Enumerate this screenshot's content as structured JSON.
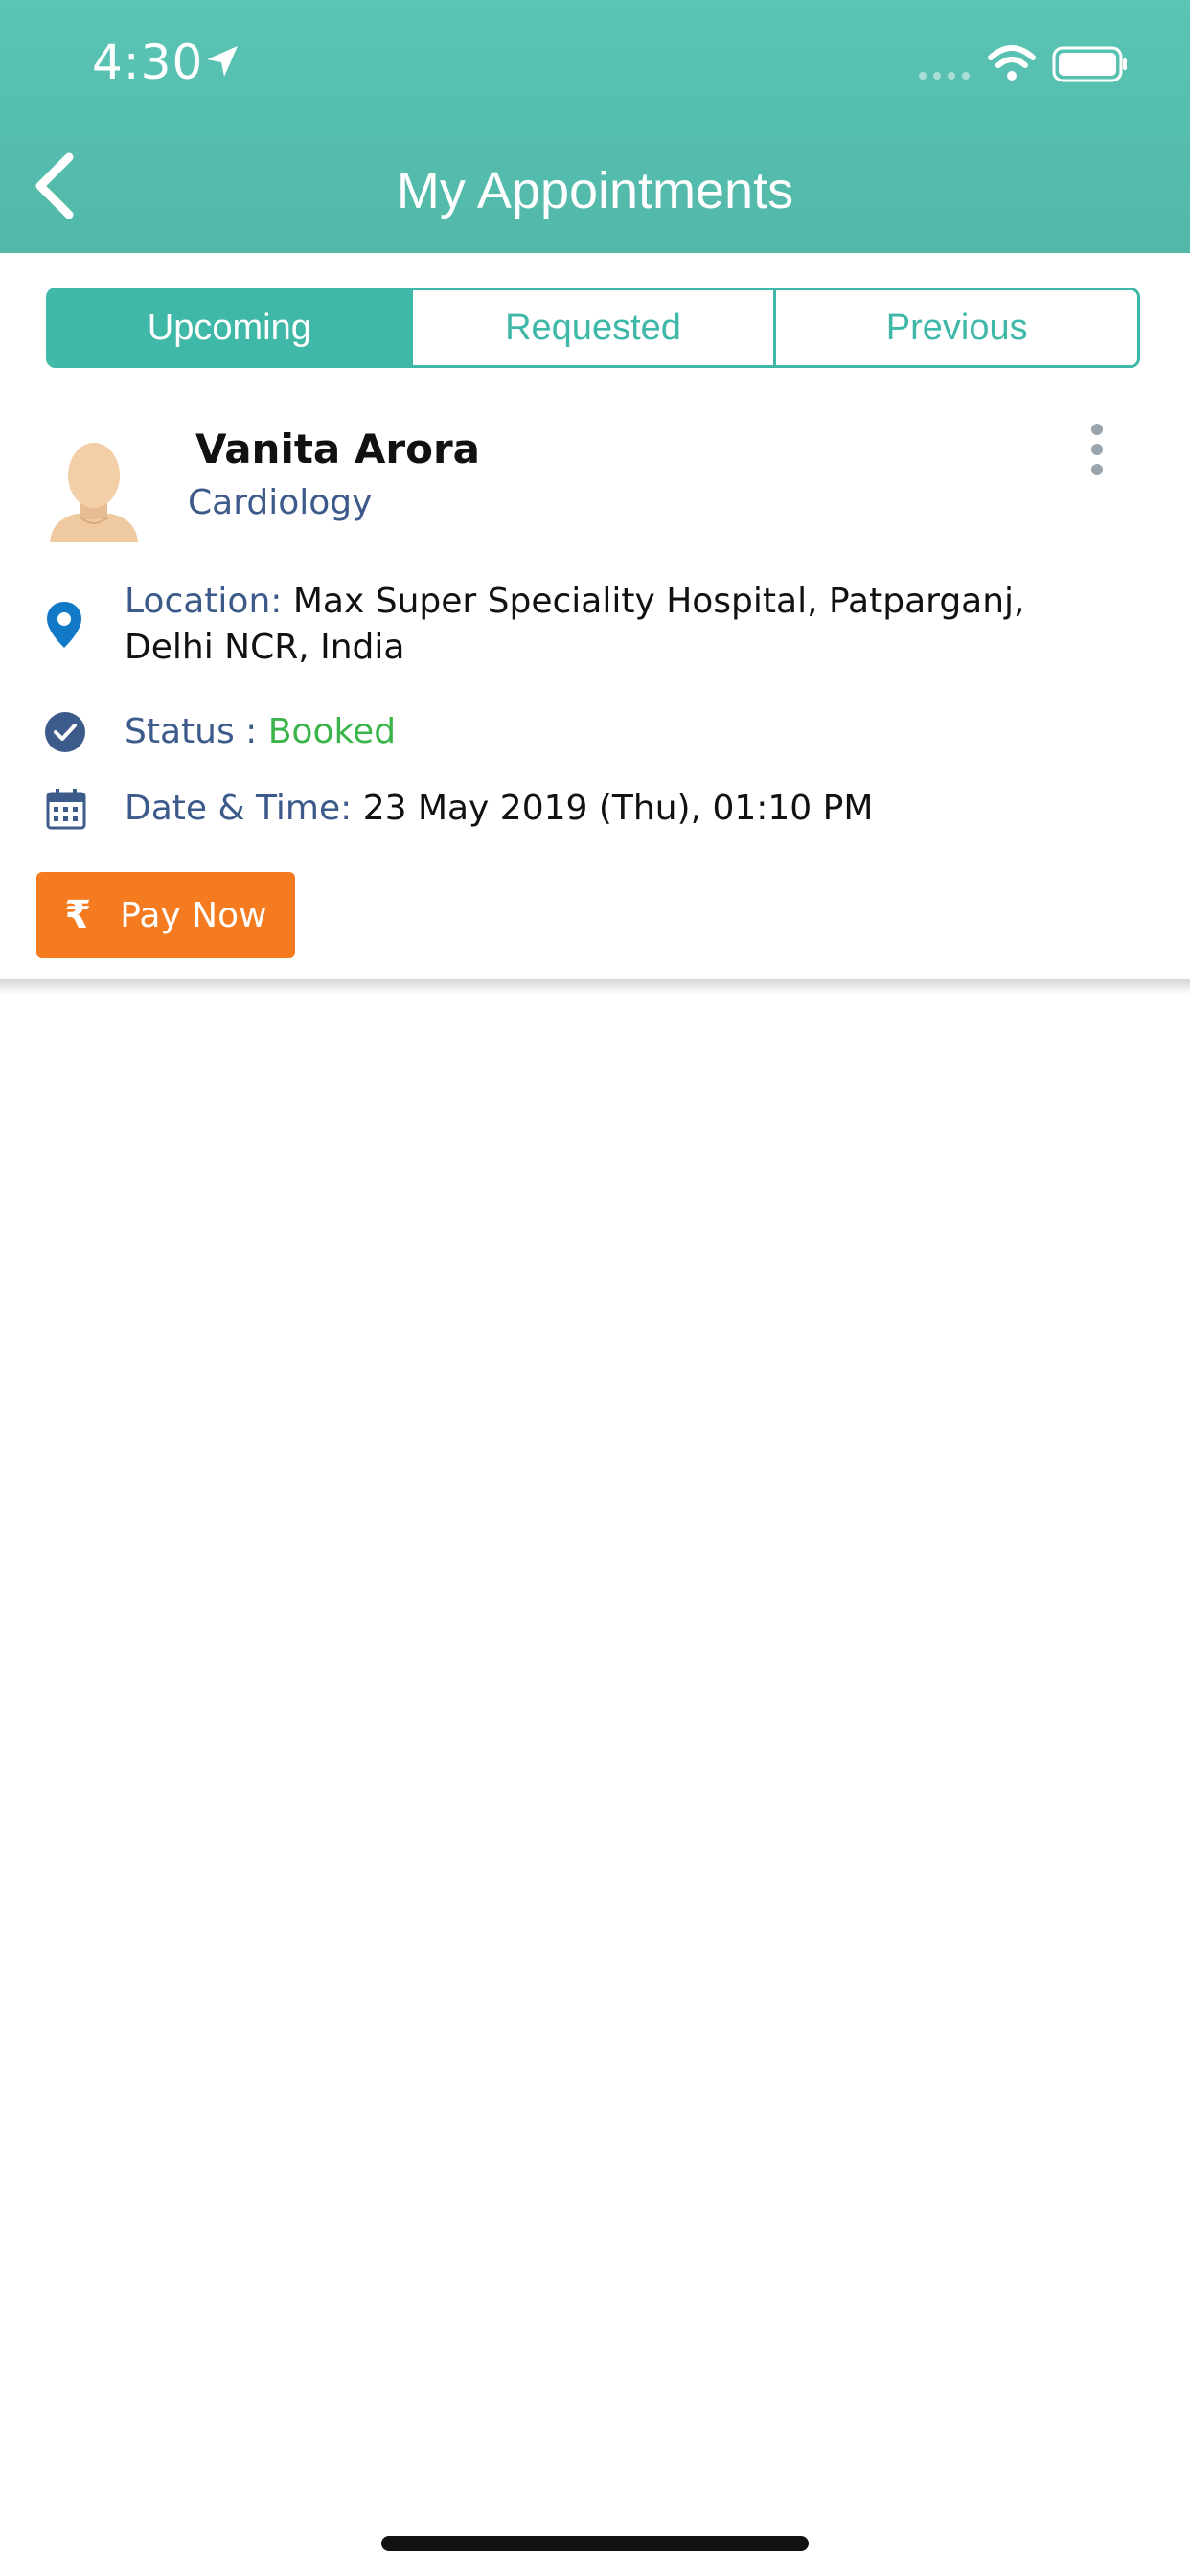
{
  "status_bar": {
    "time": "4:30"
  },
  "header": {
    "title": "My Appointments"
  },
  "tabs": [
    {
      "label": "Upcoming",
      "active": true
    },
    {
      "label": "Requested",
      "active": false
    },
    {
      "label": "Previous",
      "active": false
    }
  ],
  "appointment": {
    "doctor_name": "Vanita Arora",
    "specialty": "Cardiology",
    "location_label": "Location: ",
    "location_value": "Max Super Speciality Hospital, Patparganj, Delhi NCR, India",
    "status_label": "Status : ",
    "status_value": "Booked",
    "datetime_label": "Date & Time: ",
    "datetime_value": "23 May 2019 (Thu), 01:10 PM",
    "pay_button_symbol": "₹",
    "pay_button_label": "Pay Now"
  },
  "colors": {
    "header": "#55bdae",
    "accent": "#3fb8a8",
    "label": "#3c5a8a",
    "status_booked": "#3bb54a",
    "pay_button": "#f47b20"
  },
  "icons": {
    "back": "chevron-left-icon",
    "location": "map-pin-icon",
    "status": "check-circle-icon",
    "datetime": "calendar-icon",
    "more": "more-vertical-icon"
  }
}
